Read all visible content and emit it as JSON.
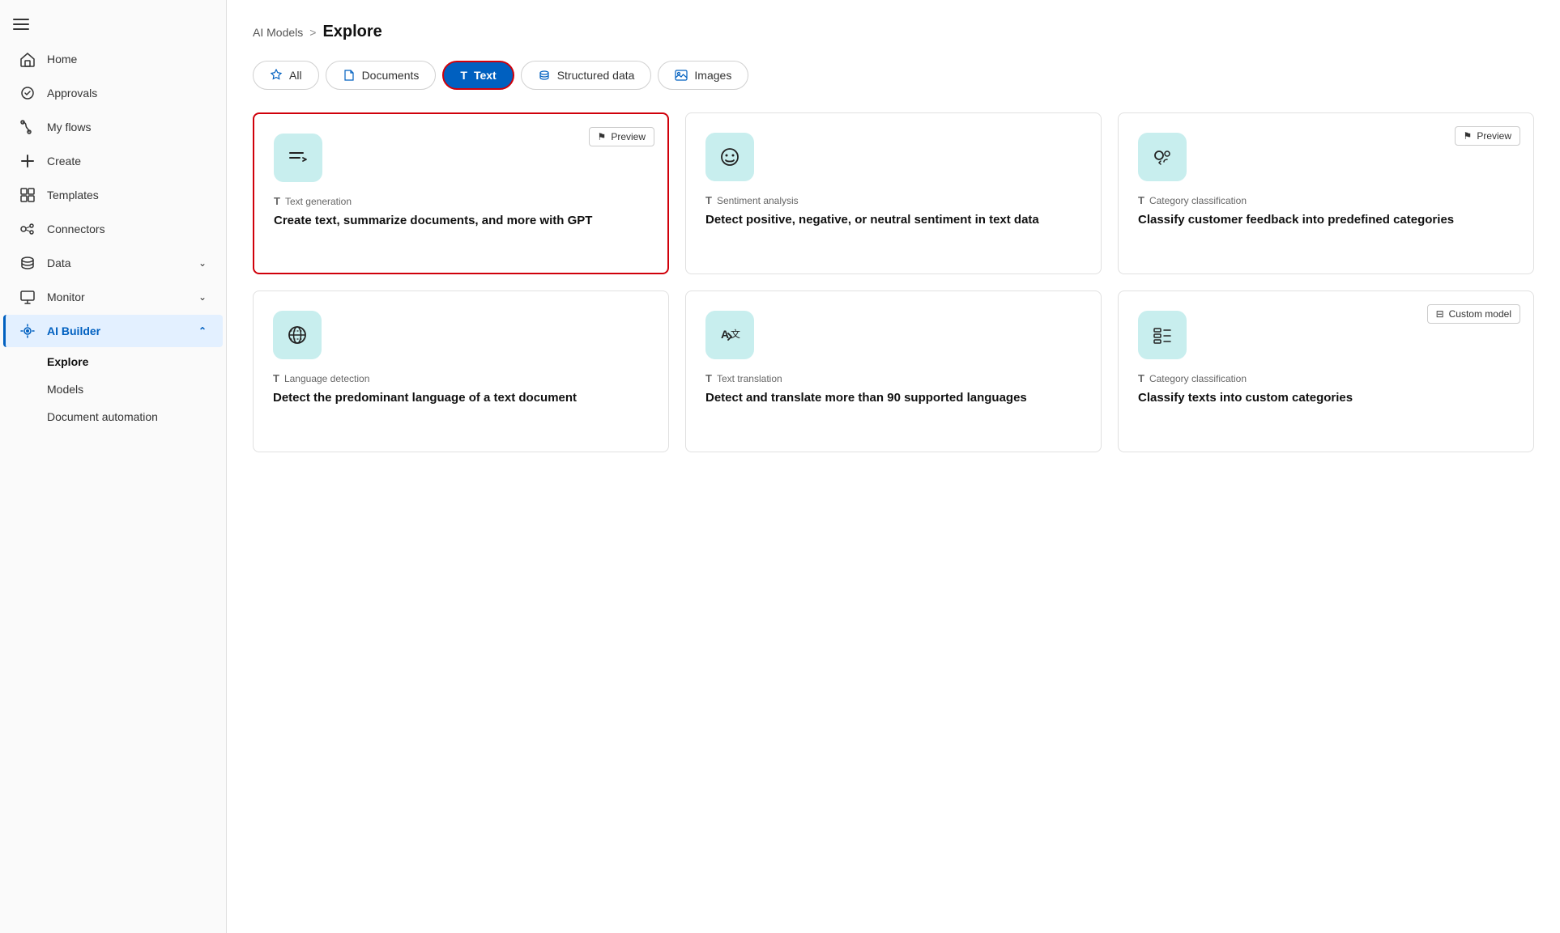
{
  "sidebar": {
    "hamburger_icon": "☰",
    "items": [
      {
        "id": "home",
        "label": "Home",
        "icon": "home"
      },
      {
        "id": "approvals",
        "label": "Approvals",
        "icon": "approvals"
      },
      {
        "id": "myflows",
        "label": "My flows",
        "icon": "flows"
      },
      {
        "id": "create",
        "label": "Create",
        "icon": "create"
      },
      {
        "id": "templates",
        "label": "Templates",
        "icon": "templates"
      },
      {
        "id": "connectors",
        "label": "Connectors",
        "icon": "connectors"
      },
      {
        "id": "data",
        "label": "Data",
        "icon": "data",
        "hasChevron": true,
        "chevronDown": true
      },
      {
        "id": "monitor",
        "label": "Monitor",
        "icon": "monitor",
        "hasChevron": true,
        "chevronDown": true
      },
      {
        "id": "aibuilder",
        "label": "AI Builder",
        "icon": "aibuilder",
        "hasChevron": true,
        "chevronUp": true,
        "active": true
      }
    ],
    "subitems": [
      {
        "id": "explore",
        "label": "Explore",
        "active": true
      },
      {
        "id": "models",
        "label": "Models"
      },
      {
        "id": "docautomation",
        "label": "Document automation"
      }
    ]
  },
  "breadcrumb": {
    "parent": "AI Models",
    "separator": ">",
    "current": "Explore"
  },
  "tabs": [
    {
      "id": "all",
      "label": "All",
      "icon": "star",
      "active": false
    },
    {
      "id": "documents",
      "label": "Documents",
      "icon": "doc",
      "active": false
    },
    {
      "id": "text",
      "label": "Text",
      "icon": "T",
      "active": true
    },
    {
      "id": "structured",
      "label": "Structured data",
      "icon": "db",
      "active": false
    },
    {
      "id": "images",
      "label": "Images",
      "icon": "img",
      "active": false
    }
  ],
  "cards": [
    {
      "id": "text-generation",
      "type": "Text generation",
      "title": "Create text, summarize documents, and more with GPT",
      "badge": "Preview",
      "hasBadge": true,
      "highlighted": true,
      "icon": "textgen"
    },
    {
      "id": "sentiment-analysis",
      "type": "Sentiment analysis",
      "title": "Detect positive, negative, or neutral sentiment in text data",
      "badge": "",
      "hasBadge": false,
      "highlighted": false,
      "icon": "sentiment"
    },
    {
      "id": "category-classification",
      "type": "Category classification",
      "title": "Classify customer feedback into predefined categories",
      "badge": "Preview",
      "hasBadge": true,
      "highlighted": false,
      "icon": "category"
    },
    {
      "id": "language-detection",
      "type": "Language detection",
      "title": "Detect the predominant language of a text document",
      "badge": "",
      "hasBadge": false,
      "highlighted": false,
      "icon": "globe"
    },
    {
      "id": "text-translation",
      "type": "Text translation",
      "title": "Detect and translate more than 90 supported languages",
      "badge": "",
      "hasBadge": false,
      "highlighted": false,
      "icon": "translate"
    },
    {
      "id": "custom-category",
      "type": "Category classification",
      "title": "Classify texts into custom categories",
      "badge": "Custom model",
      "hasBadge": true,
      "highlighted": false,
      "icon": "customcat"
    }
  ],
  "colors": {
    "active_tab_bg": "#0060c0",
    "active_tab_text": "#ffffff",
    "highlight_border": "#d0000a",
    "card_icon_bg": "#c8eeee",
    "sidebar_active_border": "#0060c0"
  }
}
